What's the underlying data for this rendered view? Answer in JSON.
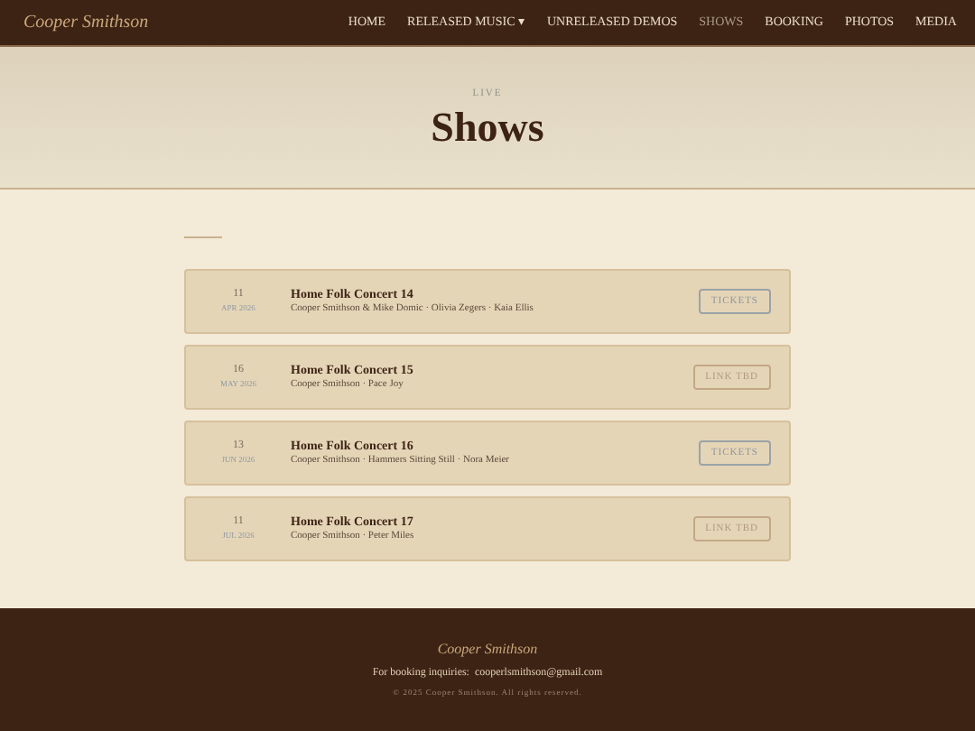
{
  "brand": "Cooper Smithson",
  "nav": [
    {
      "label": "HOME",
      "selected": false
    },
    {
      "label": "RELEASED MUSIC ▾",
      "selected": false
    },
    {
      "label": "UNRELEASED DEMOS",
      "selected": false
    },
    {
      "label": "SHOWS",
      "selected": true
    },
    {
      "label": "BOOKING",
      "selected": false
    },
    {
      "label": "PHOTOS",
      "selected": false
    },
    {
      "label": "MEDIA",
      "selected": false
    }
  ],
  "hero": {
    "eyebrow": "LIVE",
    "title": "Shows"
  },
  "shows": [
    {
      "day": "11",
      "month": "APR 2026",
      "title": "Home Folk Concert 14",
      "artists": "Cooper Smithson & Mike Domic · Olivia Zegers · Kaia Ellis",
      "action": {
        "kind": "tickets",
        "label": "TICKETS"
      }
    },
    {
      "day": "16",
      "month": "MAY 2026",
      "title": "Home Folk Concert 15",
      "artists": "Cooper Smithson · Pace Joy",
      "action": {
        "kind": "tbd",
        "label": "LINK TBD"
      }
    },
    {
      "day": "13",
      "month": "JUN 2026",
      "title": "Home Folk Concert 16",
      "artists": "Cooper Smithson · Hammers Sitting Still · Nora Meier",
      "action": {
        "kind": "tickets",
        "label": "TICKETS"
      }
    },
    {
      "day": "11",
      "month": "JUL 2026",
      "title": "Home Folk Concert 17",
      "artists": "Cooper Smithson · Peter Miles",
      "action": {
        "kind": "tbd",
        "label": "LINK TBD"
      }
    }
  ],
  "footer": {
    "name": "Cooper Smithson",
    "booking_label": "For booking inquiries:",
    "email": "cooperlsmithson@gmail.com",
    "copyright": "© 2025 Cooper Smithson. All rights reserved."
  }
}
